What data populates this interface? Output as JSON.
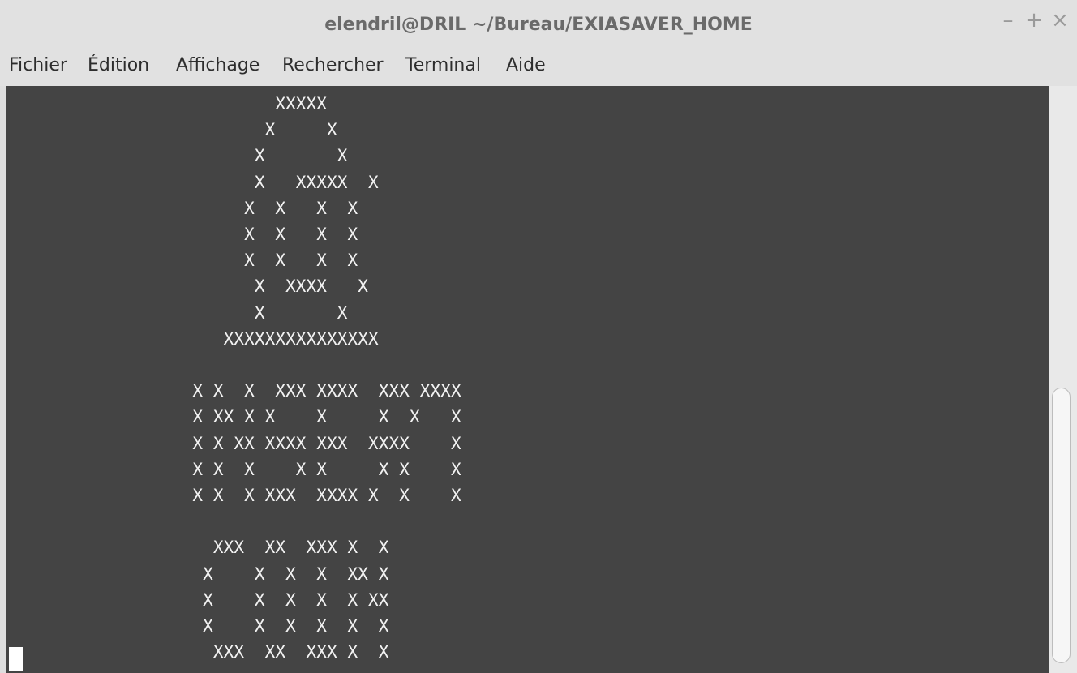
{
  "window": {
    "title": "elendril@DRIL ~/Bureau/EXIASAVER_HOME",
    "controls": {
      "minimize": "–",
      "maximize": "+",
      "close": "×"
    }
  },
  "menubar": {
    "items": [
      "Fichier",
      "Édition",
      "Affichage",
      "Rechercher",
      "Terminal",
      "Aide"
    ]
  },
  "terminal": {
    "output": "                          XXXXX\n                         X     X\n                        X       X\n                        X   XXXXX  X\n                       X  X   X  X\n                       X  X   X  X\n                       X  X   X  X\n                        X  XXXX   X\n                        X       X\n                     XXXXXXXXXXXXXXX\n\n                  X X  X  XXX XXXX  XXX XXXX\n                  X XX X X    X     X  X   X\n                  X X XX XXXX XXX  XXXX    X\n                  X X  X    X X     X X    X\n                  X X  X XXX  XXXX X  X    X\n\n                    XXX  XX  XXX X  X\n                   X    X  X  X  XX X\n                   X    X  X  X  X XX\n                   X    X  X  X  X  X\n                    XXX  XX  XXX X  X"
  },
  "icons": {
    "cursor": "block-cursor-icon"
  }
}
